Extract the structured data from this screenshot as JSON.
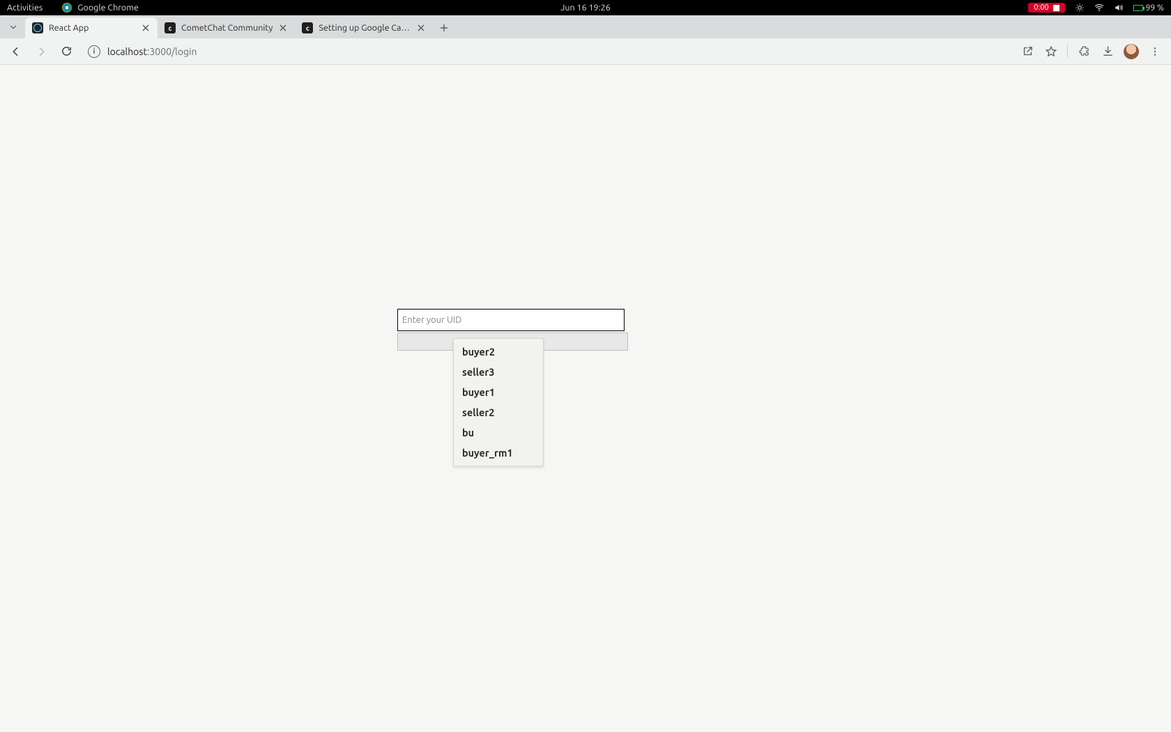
{
  "gnome": {
    "activities": "Activities",
    "app_name": "Google Chrome",
    "clock": "Jun 16  19:26",
    "recorder_time": "0:00",
    "battery_pct": "99 %"
  },
  "tabs": [
    {
      "title": "React App"
    },
    {
      "title": "CometChat Community"
    },
    {
      "title": "Setting up Google Calen"
    }
  ],
  "omnibox": {
    "host": "localhost",
    "rest": ":3000/login"
  },
  "login": {
    "placeholder": "Enter your UID",
    "value": "",
    "suggestions": [
      "buyer2",
      "seller3",
      "buyer1",
      "seller2",
      "bu",
      "buyer_rm1"
    ]
  }
}
